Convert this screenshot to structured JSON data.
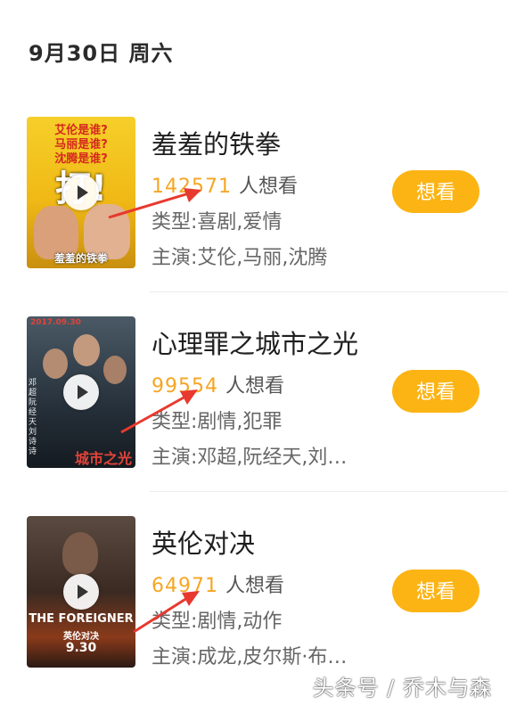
{
  "header": {
    "date": "9月30日 周六"
  },
  "movies": [
    {
      "title": "羞羞的铁拳",
      "wants_count": "142571",
      "wants_suffix": "人想看",
      "genre": "类型:喜剧,爱情",
      "cast": "主演:艾伦,马丽,沈腾",
      "button_label": "想看",
      "poster": {
        "bg": "#f3c21a",
        "lines": [
          "艾伦是谁?",
          "马丽是谁?",
          "沈腾是谁?"
        ],
        "big": "打!",
        "bottom": "羞羞的铁拳"
      }
    },
    {
      "title": "心理罪之城市之光",
      "wants_count": "99554",
      "wants_suffix": "人想看",
      "genre": "类型:剧情,犯罪",
      "cast": "主演:邓超,阮经天,刘…",
      "button_label": "想看",
      "poster": {
        "bg": "#2b3540",
        "top": "2017.09.30",
        "side": "邓超 阮经天 刘诗诗",
        "bottom": "城市之光"
      }
    },
    {
      "title": "英伦对决",
      "wants_count": "64971",
      "wants_suffix": "人想看",
      "genre": "类型:剧情,动作",
      "cast": "主演:成龙,皮尔斯·布…",
      "button_label": "想看",
      "poster": {
        "bg": "#3a2a22",
        "title": "THE FOREIGNER",
        "subtitle": "英伦对决",
        "date": "9.30"
      }
    }
  ],
  "watermark": "头条号 / 乔木与森",
  "colors": {
    "accent": "#f5a623",
    "button": "#fcb415",
    "arrow": "#e8392f"
  }
}
